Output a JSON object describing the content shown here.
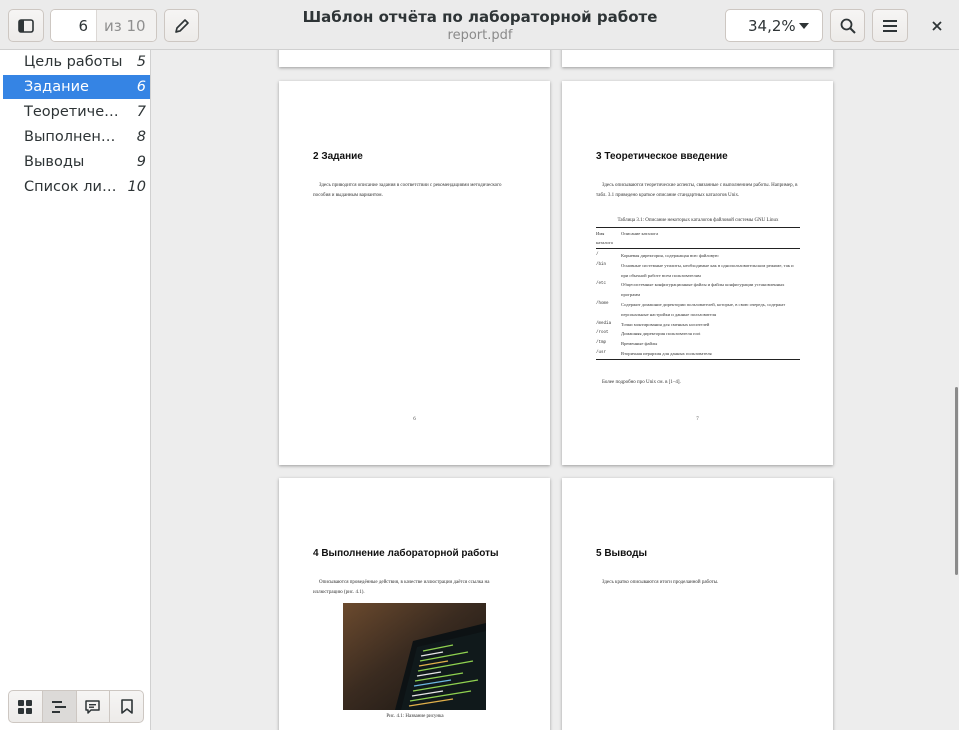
{
  "header": {
    "title": "Шаблон отчёта по лабораторной работе",
    "filename": "report.pdf",
    "page_current": "6",
    "page_total": "из 10",
    "zoom": "34,2%"
  },
  "sidebar": {
    "items": [
      {
        "label": "Цель работы",
        "page": "5"
      },
      {
        "label": "Задание",
        "page": "6"
      },
      {
        "label": "Теоретическое введение",
        "page": "7"
      },
      {
        "label": "Выполнение лабораторной работы",
        "page": "8"
      },
      {
        "label": "Выводы",
        "page": "9"
      },
      {
        "label": "Список литературы",
        "page": "10"
      }
    ]
  },
  "pages": {
    "p6": {
      "title": "2  Задание",
      "text": "Здесь приводится описание задания в соответствии с рекомендациями методического пособия и выданным вариантом.",
      "number": "6"
    },
    "p7": {
      "title": "3  Теоретическое введение",
      "text": "Здесь описываются теоретические аспекты, связанные с выполнением работы. Например, в табл. 3.1 приведено краткое описание стандартных каталогов Unix.",
      "table_caption": "Таблица 3.1: Описание некоторых каталогов файловой системы GNU Linux",
      "table_head": [
        "Имя каталога",
        "Описание каталога"
      ],
      "table_rows": [
        [
          "/",
          "Корневая директория, содержащая всю файловую"
        ],
        [
          "/bin",
          "Основные системные утилиты, необходимые как в однопользовательском режиме, так и при обычной работе всем пользователям"
        ],
        [
          "/etc",
          "Общесистемные конфигурационные файлы и файлы конфигурации установленных программ"
        ],
        [
          "/home",
          "Содержит домашние директории пользователей, которые, в свою очередь, содержат персональные настройки и данные пользователя"
        ],
        [
          "/media",
          "Точки монтирования для сменных носителей"
        ],
        [
          "/root",
          "Домашняя директория пользователя root"
        ],
        [
          "/tmp",
          "Временные файлы"
        ],
        [
          "/usr",
          "Вторичная иерархия для данных пользователя"
        ]
      ],
      "after_text": "Более подробно про Unix см. в [1–4].",
      "number": "7"
    },
    "p8": {
      "title": "4  Выполнение лабораторной работы",
      "text": "Описываются проведённые действия, в качестве иллюстрации даётся ссылка на иллюстрацию (рис. 4.1).",
      "caption": "Рис. 4.1: Название рисунка"
    },
    "p9": {
      "title": "5  Выводы",
      "text": "Здесь кратко описываются итоги проделанной работы."
    }
  }
}
